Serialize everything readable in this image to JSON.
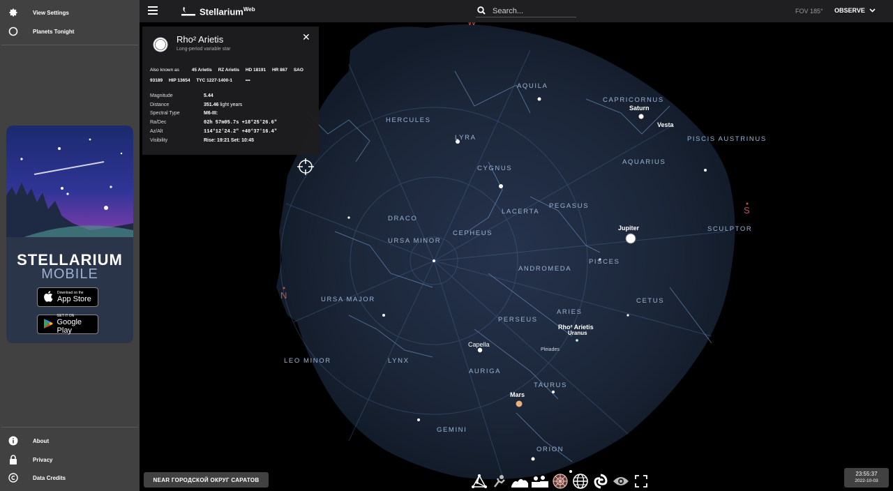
{
  "sidebar": {
    "top_items": [
      {
        "label": "View Settings",
        "icon": "gear-icon"
      },
      {
        "label": "Planets Tonight",
        "icon": "circle-icon"
      }
    ],
    "bottom_items": [
      {
        "label": "About",
        "icon": "info-icon"
      },
      {
        "label": "Privacy",
        "icon": "lock-icon"
      },
      {
        "label": "Data Credits",
        "icon": "copyright-icon"
      }
    ],
    "ad": {
      "title_line1": "STELLARIUM",
      "title_line2": "MOBILE",
      "appstore_small": "Download on the",
      "appstore_big": "App Store",
      "googleplay_small": "GET IT ON",
      "googleplay_big": "Google Play"
    }
  },
  "topbar": {
    "brand": "Stellarium",
    "brand_sup": "Web",
    "search_placeholder": "Search...",
    "fov": "FOV 185°",
    "mode": "OBSERVE"
  },
  "info": {
    "name": "Rho² Arietis",
    "type": "Long-period variable star",
    "aka_label": "Also known as",
    "aka": [
      "45 Arietis",
      "RZ Arietis",
      "HD 18191",
      "HR 867",
      "SAO 93189",
      "HIP 13654",
      "TYC 1227-1400-1"
    ],
    "more": "•••",
    "rows": [
      {
        "label": "Magnitude",
        "value": "5.44",
        "unit": ""
      },
      {
        "label": "Distance",
        "value": "351.46",
        "unit": " light years"
      },
      {
        "label": "Spectral Type",
        "value": "M6-III:",
        "unit": ""
      },
      {
        "label": "Ra/Dec",
        "value": "02h 57m05.7s  +18°25'26.6\"",
        "unit": ""
      },
      {
        "label": "Az/Alt",
        "value": "114°12'24.2\"  +40°37'16.4\"",
        "unit": ""
      },
      {
        "label": "Visibility",
        "value": "Rise: 19:21   Set: 10:45",
        "unit": ""
      }
    ]
  },
  "sky": {
    "cardinals": [
      {
        "label": "W",
        "color": "#c0524a"
      },
      {
        "label": "S",
        "color": "#c0524a"
      },
      {
        "label": "N",
        "color": "#c0524a"
      }
    ],
    "constellations": [
      "AQUILA",
      "CAPRICORNUS",
      "HERCULES",
      "LYRA",
      "PISCIS AUSTRINUS",
      "AQUARIUS",
      "CYGNUS",
      "LACERTA",
      "PEGASUS",
      "DRACO",
      "CEPHEUS",
      "URSA MINOR",
      "SCULPTOR",
      "ANDROMEDA",
      "PISCES",
      "URSA MAJOR",
      "CETUS",
      "PERSEUS",
      "ARIES",
      "LEO MINOR",
      "LYNX",
      "AURIGA",
      "TAURUS",
      "GEMINI",
      "ORION"
    ],
    "objects": [
      "Saturn",
      "Vesta",
      "Jupiter",
      "Rho² Arietis",
      "Uranus",
      "Capella",
      "Pleiades",
      "Mars"
    ]
  },
  "bottom": {
    "location": "NEAR ГОРОДСКОЙ ОКРУГ САРАТОВ",
    "time": "23:55:37",
    "date": "2022-10-03"
  },
  "colors": {
    "sidebar_bg": "#414141",
    "topbar_bg": "#1f1f21",
    "constellation_line": "#5f8fbf",
    "constellation_label": "#9ab4d4",
    "cardinal": "#c0524a"
  }
}
